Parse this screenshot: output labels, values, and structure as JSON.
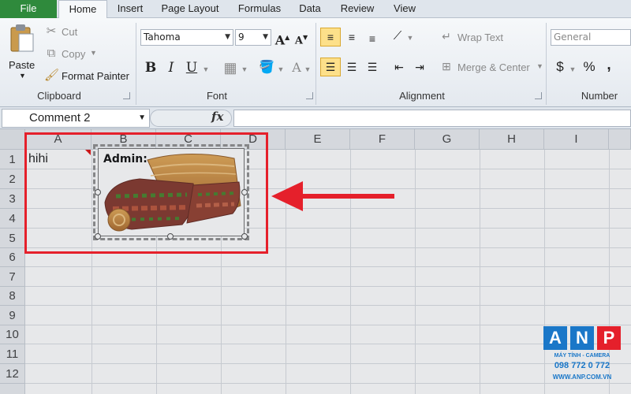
{
  "tabs": {
    "file": "File",
    "home": "Home",
    "insert": "Insert",
    "page_layout": "Page Layout",
    "formulas": "Formulas",
    "data": "Data",
    "review": "Review",
    "view": "View"
  },
  "clipboard": {
    "paste": "Paste",
    "cut": "Cut",
    "copy": "Copy",
    "format_painter": "Format Painter",
    "label": "Clipboard"
  },
  "font": {
    "name": "Tahoma",
    "size": "9",
    "label": "Font"
  },
  "alignment": {
    "wrap_text": "Wrap Text",
    "merge_center": "Merge & Center",
    "label": "Alignment"
  },
  "number": {
    "format": "General",
    "currency": "$",
    "percent": "%",
    "comma": ",",
    "label": "Number"
  },
  "formula_bar": {
    "name_box": "Comment 2",
    "fx": "fx",
    "value": ""
  },
  "grid": {
    "columns": [
      "A",
      "B",
      "C",
      "D",
      "E",
      "F",
      "G",
      "H",
      "I"
    ],
    "rows": [
      "1",
      "2",
      "3",
      "4",
      "5",
      "6",
      "7",
      "8",
      "9",
      "10",
      "11",
      "12"
    ],
    "cell_a1": "hihi"
  },
  "comment": {
    "author": "Admin:"
  },
  "watermark": {
    "letters": [
      "A",
      "N",
      "P"
    ],
    "tagline": "MÁY TÍNH - CAMERA",
    "phone": "098 772 0 772",
    "website": "WWW.ANP.COM.VN"
  },
  "colors": {
    "file_tab": "#2f8a3c",
    "highlight": "#e5202b",
    "logo_blue": "#1a77c8",
    "logo_red": "#e5202b"
  }
}
